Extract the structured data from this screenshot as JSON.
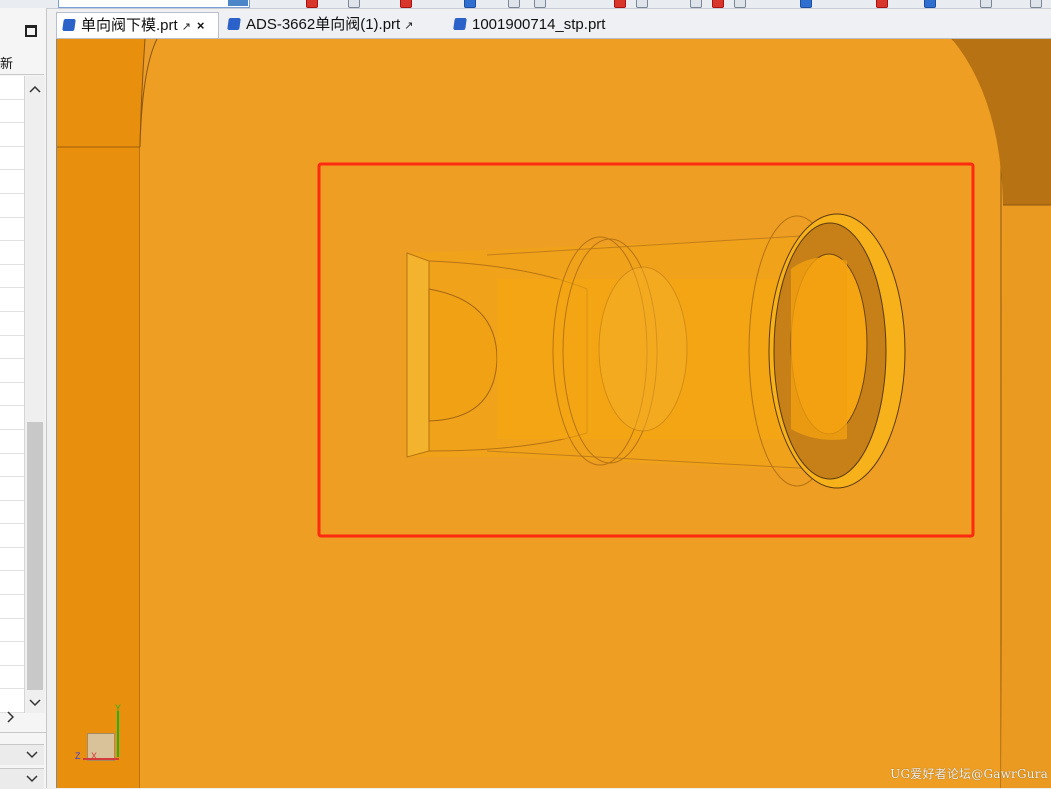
{
  "tabs": [
    {
      "label": "单向阀下模.prt",
      "active": true,
      "icon": "part-icon",
      "popout": "↗",
      "close": "×"
    },
    {
      "label": "ADS-3662单向阀(1).prt",
      "active": false,
      "icon": "part-icon",
      "popout": "↗"
    },
    {
      "label": "1001900714_stp.prt",
      "active": false,
      "icon": "part-icon"
    }
  ],
  "sidebar": {
    "header_text": "新",
    "scroll_up": "^",
    "scroll_down": "v",
    "expand": ">",
    "dropdown": "v"
  },
  "triad": {
    "y": "Y",
    "z": "Z",
    "x": "X"
  },
  "watermark": "UG爱好者论坛@GawrGura",
  "colors": {
    "viewport_bg": "#ec9c28",
    "highlight_box": "#ff2a12",
    "part": "#f5a30f"
  }
}
